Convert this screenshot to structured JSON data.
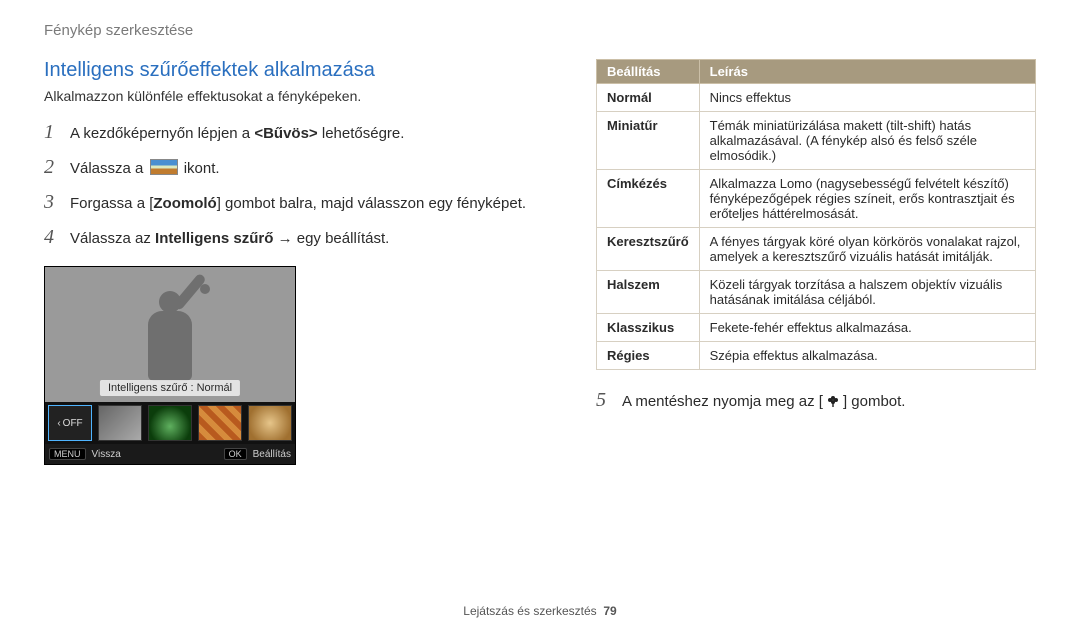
{
  "breadcrumb": "Fénykép szerkesztése",
  "heading": "Intelligens szűrőeffektek alkalmazása",
  "lead": "Alkalmazzon különféle effektusokat a fényképeken.",
  "steps": {
    "s1_a": "A kezdőképernyőn lépjen a ",
    "s1_b": "<Bűvös>",
    "s1_c": " lehetőségre.",
    "s2_a": "Válassza a ",
    "s2_b": " ikont.",
    "s3_a": "Forgassa a [",
    "s3_b": "Zoomoló",
    "s3_c": "] gombot balra, majd válasszon egy fényképet.",
    "s4_a": "Válassza az ",
    "s4_b": "Intelligens szűrő",
    "s4_c": " → egy beállítást.",
    "s5_a": "A mentéshez nyomja meg az [",
    "s5_b": "] gombot."
  },
  "preview": {
    "caption": "Intelligens szűrő : Normál",
    "off": "OFF",
    "back_tag": "MENU",
    "back_lbl": "Vissza",
    "set_tag": "OK",
    "set_lbl": "Beállítás"
  },
  "table": {
    "h1": "Beállítás",
    "h2": "Leírás",
    "rows": [
      {
        "k": "Normál",
        "v": "Nincs effektus"
      },
      {
        "k": "Miniatűr",
        "v": "Témák miniatürizálása makett (tilt-shift) hatás alkalmazásával. (A fénykép alsó és felső széle elmosódik.)"
      },
      {
        "k": "Címkézés",
        "v": "Alkalmazza Lomo (nagysebességű felvételt készítő) fényképezőgépek régies színeit, erős kontrasztjait és erőteljes háttérelmosását."
      },
      {
        "k": "Keresztszűrő",
        "v": "A fényes tárgyak köré olyan körkörös vonalakat rajzol, amelyek a keresztszűrő vizuális hatását imitálják."
      },
      {
        "k": "Halszem",
        "v": "Közeli tárgyak torzítása a halszem objektív vizuális hatásának imitálása céljából."
      },
      {
        "k": "Klasszikus",
        "v": "Fekete-fehér effektus alkalmazása."
      },
      {
        "k": "Régies",
        "v": "Szépia effektus alkalmazása."
      }
    ]
  },
  "footer": {
    "section": "Lejátszás és szerkesztés",
    "page": "79"
  }
}
